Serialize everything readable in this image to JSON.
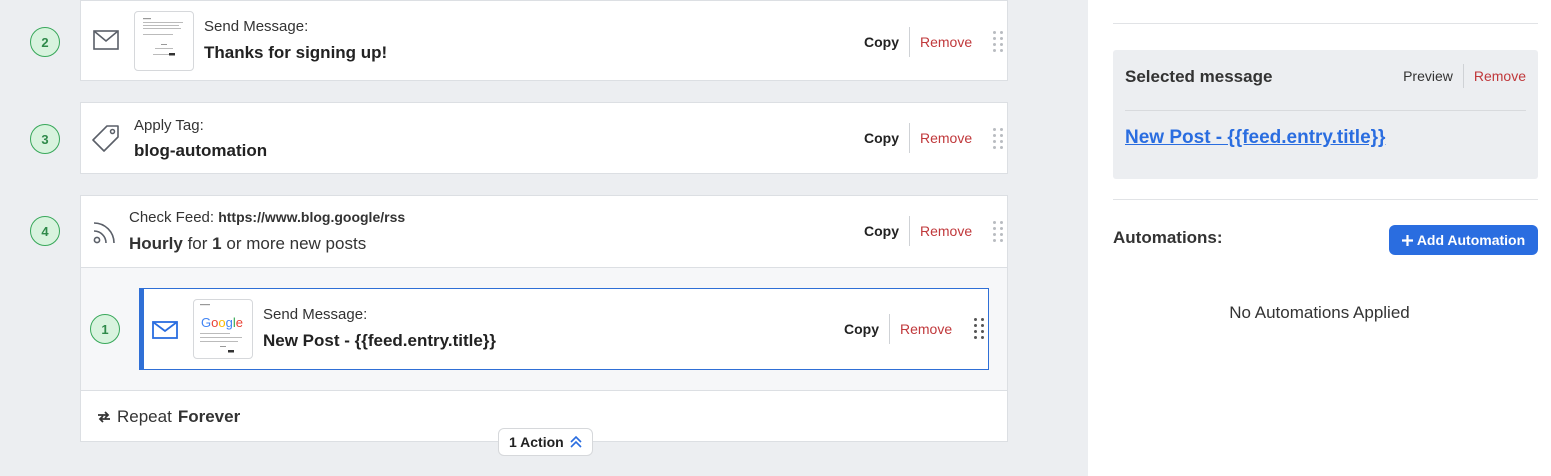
{
  "steps": [
    {
      "number": "2",
      "label": "Send Message:",
      "value": "Thanks for signing up!",
      "icon": "envelope-icon"
    },
    {
      "number": "3",
      "label": "Apply Tag:",
      "value": "blog-automation",
      "icon": "tag-icon"
    },
    {
      "number": "4",
      "label": "Check Feed:",
      "feed_url": "https://www.blog.google/rss",
      "freq": "Hourly",
      "for_text": "for",
      "count": "1",
      "suffix": "or more new posts",
      "icon": "rss-icon"
    }
  ],
  "nested_step": {
    "number": "1",
    "label": "Send Message:",
    "value": "New Post - {{feed.entry.title}}",
    "icon": "envelope-icon",
    "thumb_logo": "Google"
  },
  "actions": {
    "copy": "Copy",
    "remove": "Remove"
  },
  "repeat": {
    "prefix": "Repeat",
    "mode": "Forever"
  },
  "action_pill": "1 Action",
  "selected_message": {
    "title": "Selected message",
    "preview": "Preview",
    "remove": "Remove",
    "link": "New Post - {{feed.entry.title}}"
  },
  "automations": {
    "title": "Automations:",
    "add_button": "Add Automation",
    "empty": "No Automations Applied"
  },
  "colors": {
    "accent": "#2a6de0",
    "remove": "#c0383b",
    "step_green": "#38a85a"
  }
}
